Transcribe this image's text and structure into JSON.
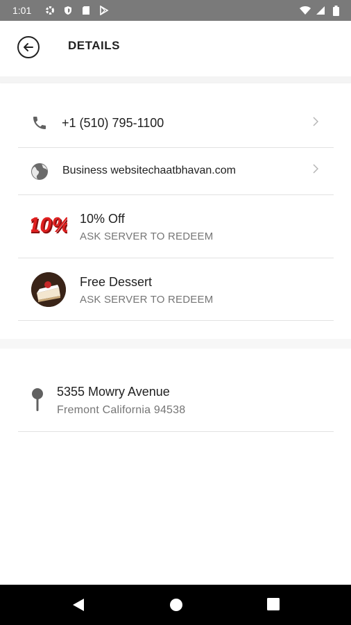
{
  "status_bar": {
    "time": "1:01",
    "left_icons": [
      "settings-icon",
      "shield-icon",
      "sd-card-icon",
      "play-store-icon"
    ],
    "right_icons": [
      "wifi-icon",
      "signal-icon",
      "battery-icon"
    ],
    "background": "#7a7a7a"
  },
  "app_bar": {
    "title": "DETAILS",
    "back_icon": "back-arrow-icon"
  },
  "contact": {
    "phone": "+1 (510) 795-1100",
    "website": "Business websitechaatbhavan.com"
  },
  "offers": [
    {
      "title": "10% Off",
      "subtitle": "ASK SERVER TO REDEEM",
      "icon": "ten-percent-badge-icon"
    },
    {
      "title": "Free Dessert",
      "subtitle": "ASK SERVER TO REDEEM",
      "icon": "cake-slice-icon"
    }
  ],
  "address": {
    "line1": "5355 Mowry Avenue",
    "line2": "Fremont California 94538",
    "icon": "map-pin-icon"
  },
  "nav_bar": {
    "icons": [
      "nav-back-icon",
      "nav-home-icon",
      "nav-recents-icon"
    ]
  },
  "colors": {
    "primary_text": "#212121",
    "secondary_text": "#757575",
    "divider": "#e2e2e2",
    "badge_red": "#e02020"
  }
}
